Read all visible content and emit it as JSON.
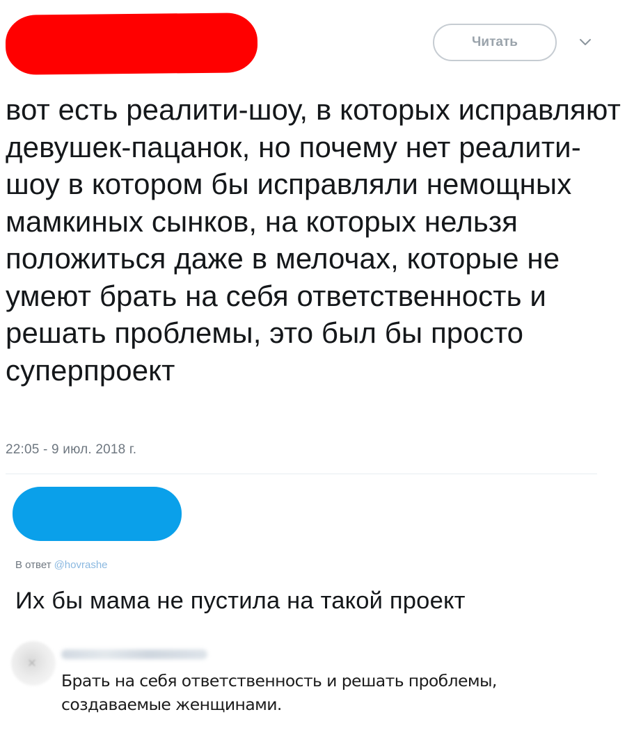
{
  "tweet": {
    "author_redacted_color": "#ff0000",
    "follow_label": "Читать",
    "caret_icon": "chevron-down-icon",
    "text": "вот есть реалити-шоу, в которых исправляют девушек-пацанок, но почему нет реалити-шоу в котором бы исправляли немощных мамкиных сынков, на которых нельзя положиться даже в мелочах, которые не умеют брать на себя ответственность и решать проблемы, это был бы просто суперпроект",
    "timestamp": "22:05 - 9 июл. 2018 г."
  },
  "reply": {
    "author_redacted_color": "#0aa0ea",
    "in_reply_to_label": "В ответ",
    "in_reply_to_handle": "@hovrashe",
    "text": "Их бы мама не пустила на такой проект"
  },
  "comment": {
    "avatar_icon": "avatar-icon",
    "text": "Брать на себя ответственность и решать проблемы, создаваемые женщинами."
  }
}
